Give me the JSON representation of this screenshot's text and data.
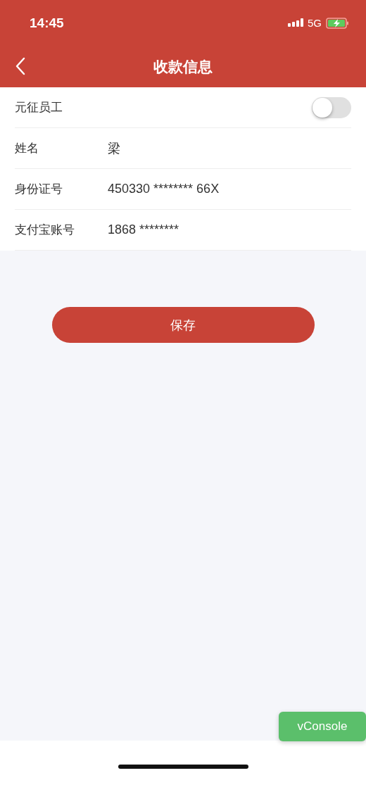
{
  "status_bar": {
    "time": "14:45",
    "network": "5G"
  },
  "nav": {
    "title": "收款信息"
  },
  "rows": [
    {
      "kind": "toggle",
      "label": "元征员工",
      "on": false
    },
    {
      "kind": "field",
      "label": "姓名",
      "value": "梁"
    },
    {
      "kind": "field",
      "label": "身份证号",
      "value": "450330 ******** 66X"
    },
    {
      "kind": "field",
      "label": "支付宝账号",
      "value": "1868 ********"
    }
  ],
  "save_button": "保存",
  "vconsole_button": "vConsole"
}
